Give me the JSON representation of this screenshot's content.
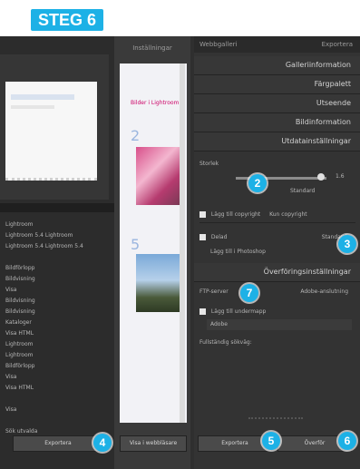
{
  "step_label": "STEG 6",
  "left_panel": {
    "list_lines": [
      "Lightroom",
      "Lightroom 5.4 Lightroom",
      "Lightroom 5.4 Lightroom 5.4",
      "",
      "Bildförlopp",
      "Bildvisning",
      "Visa",
      "Bildvisning",
      "Bildvisning",
      "Kataloger",
      "Visa HTML",
      "Lightroom",
      "Lightroom",
      "Bildförlopp",
      "Visa",
      "Visa HTML",
      "",
      "Visa",
      "",
      "Sök utvalda"
    ],
    "bottom_button": "Exportera"
  },
  "middle_panel": {
    "header": "Inställningar",
    "caption": "Bilder i Lightroom",
    "thumb_numbers": [
      "2",
      "5"
    ],
    "bottom_button": "Visa i webbläsare"
  },
  "right_panel": {
    "top_title": "Webbgalleri",
    "top_right": "Exportera",
    "sections": [
      "Galleriinformation",
      "Färgpalett",
      "Utseende",
      "Bildinformation",
      "Utdatainställningar"
    ],
    "quality_label": "Storlek",
    "quality_value": "1.6",
    "quality_note": "Standard",
    "checkbox1_label": "Lägg till copyright",
    "checkbox1_value": "Kun copyright",
    "checkbox2_label": "Delad",
    "checkbox2_right": "Standard",
    "checkbox2_sub": "Lägg till i Photoshop",
    "upload_section": "Överföringsinställningar",
    "ftp_label": "FTP-server",
    "ftp_value": "Adobe-anslutning",
    "checkbox3_label": "Lägg till undermapp",
    "sub_path": "Adobe",
    "full_path": "Fullständig sökväg:",
    "bottom_buttons": [
      "Exportera",
      "Överför"
    ]
  },
  "callouts": [
    "2",
    "3",
    "4",
    "5",
    "6",
    "7"
  ]
}
